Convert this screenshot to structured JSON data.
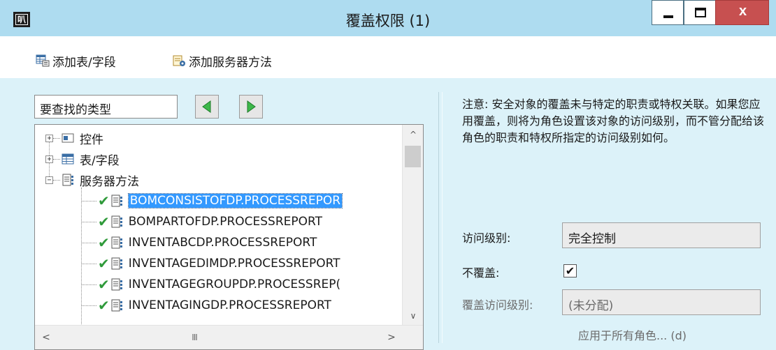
{
  "window": {
    "title": "覆盖权限 (1)",
    "app_icon_text": "叭",
    "controls": {
      "minimize_icon": "minimize-icon",
      "maximize_icon": "maximize-icon",
      "close_label": "x"
    }
  },
  "toolbar": {
    "add_table_field": "添加表/字段",
    "add_server_method": "添加服务器方法"
  },
  "search": {
    "value": "要查找的类型"
  },
  "tree": {
    "groups": [
      {
        "label": "控件",
        "expander": "+",
        "icon": "control-icon"
      },
      {
        "label": "表/字段",
        "expander": "+",
        "icon": "table-icon"
      },
      {
        "label": "服务器方法",
        "expander": "−",
        "icon": "server-method-icon"
      }
    ],
    "items": [
      {
        "label": "BOMCONSISTOFDP.PROCESSREPOR",
        "checked": true,
        "selected": true
      },
      {
        "label": "BOMPARTOFDP.PROCESSREPORT",
        "checked": true,
        "selected": false
      },
      {
        "label": "INVENTABCDP.PROCESSREPORT",
        "checked": true,
        "selected": false
      },
      {
        "label": "INVENTAGEDIMDP.PROCESSREPORT",
        "checked": true,
        "selected": false
      },
      {
        "label": "INVENTAGEGROUPDP.PROCESSREP(",
        "checked": true,
        "selected": false
      },
      {
        "label": "INVENTAGINGDP.PROCESSREPORT",
        "checked": true,
        "selected": false
      }
    ],
    "scroll": {
      "up": "^",
      "down": "∨",
      "left": "<",
      "right": ">",
      "grip": "III"
    }
  },
  "note": "注意: 安全对象的覆盖未与特定的职责或特权关联。如果您应用覆盖，则将为角色设置该对象的访问级别，而不管分配给该角色的职责和特权所指定的访问级别如何。",
  "form": {
    "access_level_label": "访问级别:",
    "access_level_value": "完全控制",
    "no_override_label": "不覆盖:",
    "no_override_checked": true,
    "no_override_mark": "✔",
    "override_level_label": "覆盖访问级别:",
    "override_level_value": "(未分配)",
    "apply_all_roles": "应用于所有角色... (d)"
  },
  "colors": {
    "titlebar": "#aedcf0",
    "content_bg": "#dcf2f9",
    "selection": "#3399ff",
    "close_button": "#c75050",
    "check_green": "#2f9a3a"
  }
}
